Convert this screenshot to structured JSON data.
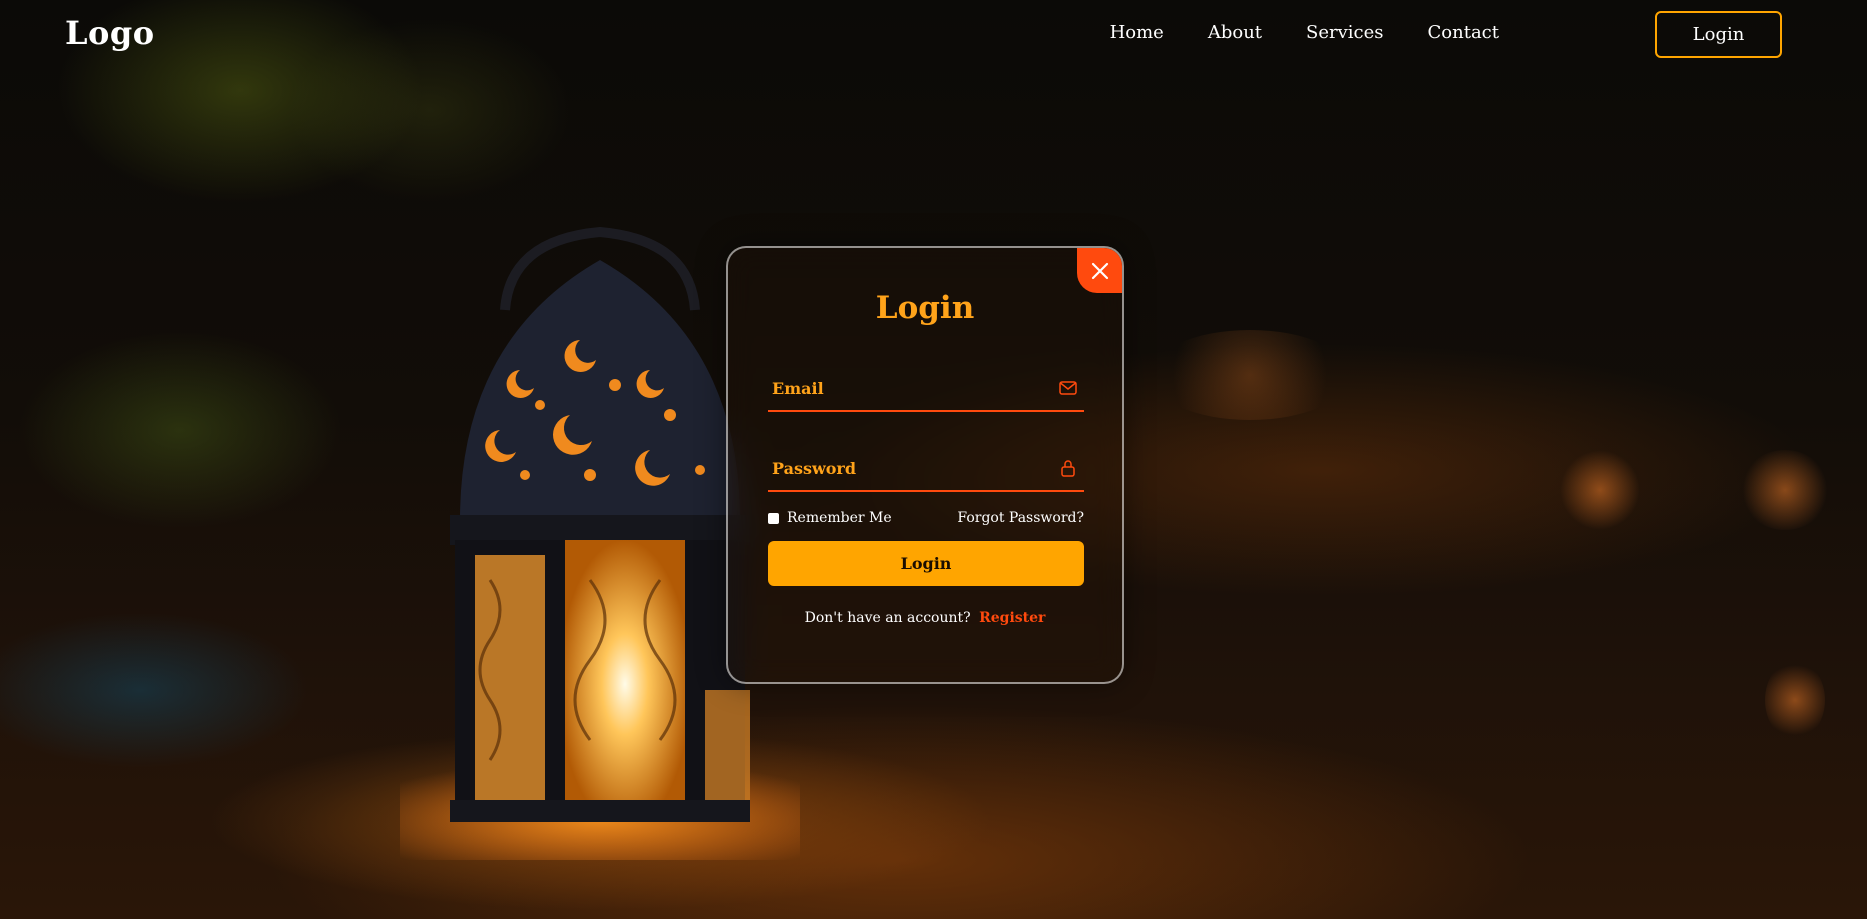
{
  "header": {
    "logo": "Logo",
    "nav": [
      "Home",
      "About",
      "Services",
      "Contact"
    ],
    "login_button": "Login"
  },
  "form": {
    "title": "Login",
    "email_placeholder": "Email",
    "password_placeholder": "Password",
    "remember_label": "Remember Me",
    "forgot_label": "Forgot Password?",
    "submit_label": "Login",
    "register_prompt": "Don't have an account?",
    "register_link": "Register"
  },
  "icons": {
    "close": "close-icon",
    "email": "mail-icon",
    "password": "lock-icon"
  },
  "colors": {
    "accent": "#ffa500",
    "highlight": "#ff4a0e",
    "title": "#ffa31a"
  }
}
